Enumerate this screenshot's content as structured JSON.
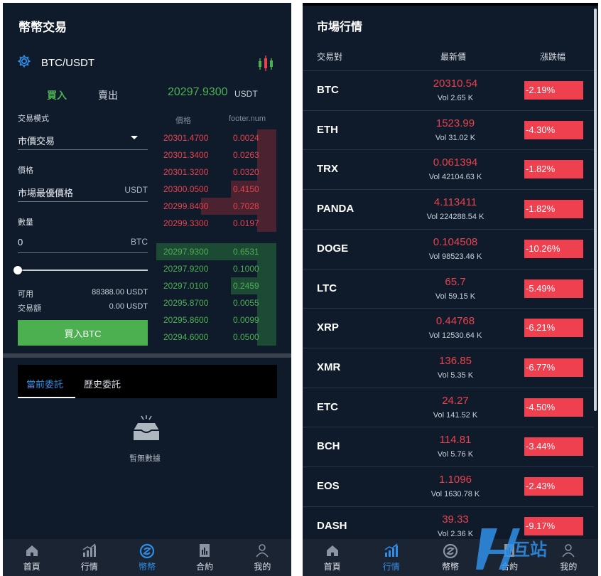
{
  "left": {
    "title": "幣幣交易",
    "pair": "BTC/USDT",
    "tab_buy": "買入",
    "tab_sell": "賣出",
    "last_price": "20297.9300",
    "last_price_unit": "USDT",
    "trade_mode_label": "交易模式",
    "trade_mode_value": "市價交易",
    "price_label": "價格",
    "price_value": "市場最優價格",
    "price_unit": "USDT",
    "amount_label": "數量",
    "amount_value": "0",
    "amount_unit": "BTC",
    "slider_percent": 0,
    "available_label": "可用",
    "available_value": "88388.00 USDT",
    "volume_label": "交易額",
    "volume_value": "0.00 USDT",
    "buy_button": "買入BTC",
    "orderbook": {
      "header_price": "價格",
      "header_qty": "footer.num",
      "asks": [
        {
          "price": "20301.4700",
          "qty": "0.0024",
          "depth": 0.16
        },
        {
          "price": "20301.3400",
          "qty": "0.0263",
          "depth": 0.16
        },
        {
          "price": "20301.3200",
          "qty": "0.0320",
          "depth": 0.16
        },
        {
          "price": "20300.0500",
          "qty": "0.4150",
          "depth": 0.38
        },
        {
          "price": "20299.8400",
          "qty": "0.7028",
          "depth": 0.63
        },
        {
          "price": "20299.3300",
          "qty": "0.0197",
          "depth": 0.16
        }
      ],
      "bids": [
        {
          "price": "20297.9300",
          "qty": "0.6531",
          "depth": 1.0
        },
        {
          "price": "20297.9200",
          "qty": "0.1000",
          "depth": 0.16
        },
        {
          "price": "20297.0100",
          "qty": "0.2459",
          "depth": 0.38
        },
        {
          "price": "20295.8700",
          "qty": "0.0055",
          "depth": 0.16
        },
        {
          "price": "20295.8600",
          "qty": "0.0099",
          "depth": 0.16
        },
        {
          "price": "20294.6000",
          "qty": "0.0500",
          "depth": 0.16
        }
      ]
    },
    "orders_tab_current": "當前委託",
    "orders_tab_history": "歷史委託",
    "empty_text": "暫無數據",
    "nav": [
      {
        "label": "首頁",
        "icon": "home-icon"
      },
      {
        "label": "行情",
        "icon": "market-icon"
      },
      {
        "label": "幣幣",
        "icon": "coin-icon",
        "active": true
      },
      {
        "label": "合約",
        "icon": "contract-icon"
      },
      {
        "label": "我的",
        "icon": "profile-icon"
      }
    ]
  },
  "right": {
    "title": "市場行情",
    "col_pair": "交易對",
    "col_price": "最新價",
    "col_change": "漲跌幅",
    "rows": [
      {
        "symbol": "BTC",
        "price": "20310.54",
        "vol": "Vol 2.65 K",
        "change": "-2.19%"
      },
      {
        "symbol": "ETH",
        "price": "1523.99",
        "vol": "Vol 31.02 K",
        "change": "-4.30%"
      },
      {
        "symbol": "TRX",
        "price": "0.061394",
        "vol": "Vol 42104.63 K",
        "change": "-1.82%"
      },
      {
        "symbol": "PANDA",
        "price": "4.113411",
        "vol": "Vol 224288.54 K",
        "change": "-1.82%"
      },
      {
        "symbol": "DOGE",
        "price": "0.104508",
        "vol": "Vol 98523.46 K",
        "change": "-10.26%"
      },
      {
        "symbol": "LTC",
        "price": "65.7",
        "vol": "Vol 59.15 K",
        "change": "-5.49%"
      },
      {
        "symbol": "XRP",
        "price": "0.44768",
        "vol": "Vol 12530.64 K",
        "change": "-6.21%"
      },
      {
        "symbol": "XMR",
        "price": "136.85",
        "vol": "Vol 5.35 K",
        "change": "-6.77%"
      },
      {
        "symbol": "ETC",
        "price": "24.27",
        "vol": "Vol 141.52 K",
        "change": "-4.50%"
      },
      {
        "symbol": "BCH",
        "price": "114.81",
        "vol": "Vol 5.76 K",
        "change": "-3.44%"
      },
      {
        "symbol": "EOS",
        "price": "1.1096",
        "vol": "Vol 1630.78 K",
        "change": "-2.43%"
      },
      {
        "symbol": "DASH",
        "price": "39.33",
        "vol": "Vol 2.36 K",
        "change": "-9.17%"
      }
    ],
    "nav": [
      {
        "label": "首頁",
        "icon": "home-icon"
      },
      {
        "label": "行情",
        "icon": "market-icon",
        "active": true
      },
      {
        "label": "幣幣",
        "icon": "coin-icon"
      },
      {
        "label": "合約",
        "icon": "contract-icon"
      },
      {
        "label": "我的",
        "icon": "profile-icon"
      }
    ]
  },
  "watermark_text": "互站",
  "colors": {
    "panel_bg": "#0f1b2b",
    "up_green": "#4caf50",
    "down_red": "#e8424c",
    "accent_blue": "#2f8fe8"
  }
}
